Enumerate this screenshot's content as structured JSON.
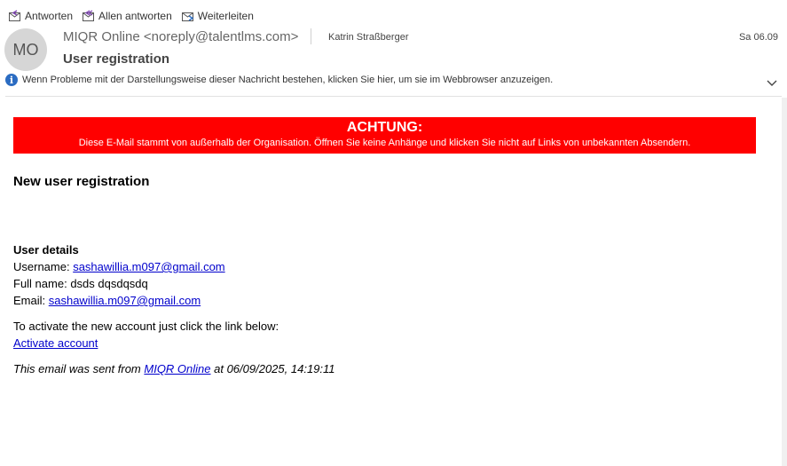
{
  "toolbar": {
    "reply_label": "Antworten",
    "reply_all_label": "Allen antworten",
    "forward_label": "Weiterleiten"
  },
  "header": {
    "avatar_initials": "MO",
    "sender": "MIQR Online <noreply@talentlms.com>",
    "recipient": "Katrin Straßberger",
    "date": "Sa 06.09",
    "subject": "User registration",
    "info_text": "Wenn Probleme mit der Darstellungsweise dieser Nachricht bestehen, klicken Sie hier, um sie im Webbrowser anzuzeigen."
  },
  "warning": {
    "title": "ACHTUNG:",
    "text": "Diese E-Mail stammt von außerhalb der Organisation. Öffnen Sie keine Anhänge und klicken Sie nicht auf Links von unbekannten Absendern.",
    "color": "#ff0000"
  },
  "body": {
    "heading": "New user registration",
    "details_title": "User details",
    "username_label": "Username: ",
    "username_value": "sashawillia.m097@gmail.com",
    "fullname_label": "Full name: ",
    "fullname_value": "dsds dqsdqsdq",
    "email_label": "Email: ",
    "email_value": "sashawillia.m097@gmail.com",
    "activate_text": "To activate the new account just click the link below:",
    "activate_link": "Activate account",
    "footer_prefix": "This email was sent from ",
    "footer_link": "MIQR Online",
    "footer_suffix": " at 06/09/2025, 14:19:11"
  }
}
